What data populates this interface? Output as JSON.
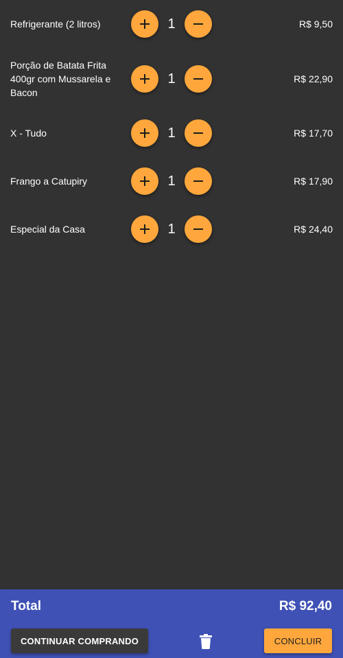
{
  "cart": {
    "items": [
      {
        "name": "Refrigerante (2 litros)",
        "quantity": "1",
        "price": "R$ 9,50"
      },
      {
        "name": "Porção de Batata Frita 400gr com Mussarela e Bacon",
        "quantity": "1",
        "price": "R$ 22,90"
      },
      {
        "name": "X - Tudo",
        "quantity": "1",
        "price": "R$ 17,70"
      },
      {
        "name": "Frango a Catupiry",
        "quantity": "1",
        "price": "R$ 17,90"
      },
      {
        "name": "Especial da Casa",
        "quantity": "1",
        "price": "R$ 24,40"
      }
    ],
    "icons": {
      "increase": "plus-icon",
      "decrease": "minus-icon"
    }
  },
  "footer": {
    "total_label": "Total",
    "total_value": "R$ 92,40",
    "continue_label": "CONTINUAR COMPRANDO",
    "trash_icon": "trash-icon",
    "conclude_label": "CONCLUIR"
  },
  "colors": {
    "background": "#323232",
    "accent": "#ffa73c",
    "footer": "#3f51b5",
    "dark_button": "#3a3a3a"
  }
}
